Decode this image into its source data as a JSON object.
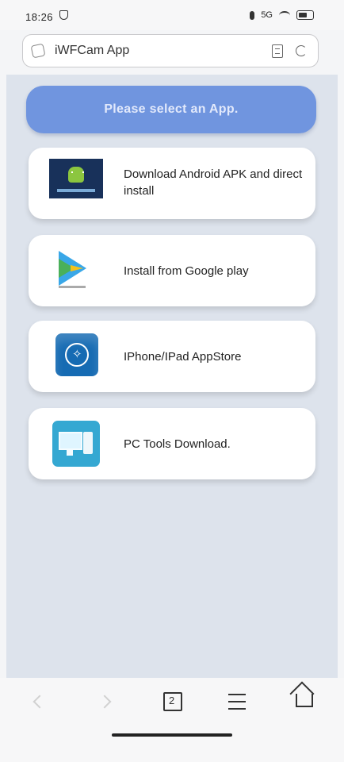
{
  "status": {
    "time": "18:26",
    "network": "5G"
  },
  "browser": {
    "title": "iWFCam App"
  },
  "header": {
    "label": "Please select an App."
  },
  "options": [
    {
      "label": "Download Android APK and direct install",
      "icon": "android-apk-icon"
    },
    {
      "label": "Install from Google play",
      "icon": "google-play-icon"
    },
    {
      "label": "IPhone/IPad AppStore",
      "icon": "appstore-icon"
    },
    {
      "label": "PC Tools Download.",
      "icon": "pc-tools-icon"
    }
  ],
  "navigation": {
    "tab_count": "2"
  },
  "colors": {
    "accent": "#7095df",
    "background": "#dde3ec"
  }
}
